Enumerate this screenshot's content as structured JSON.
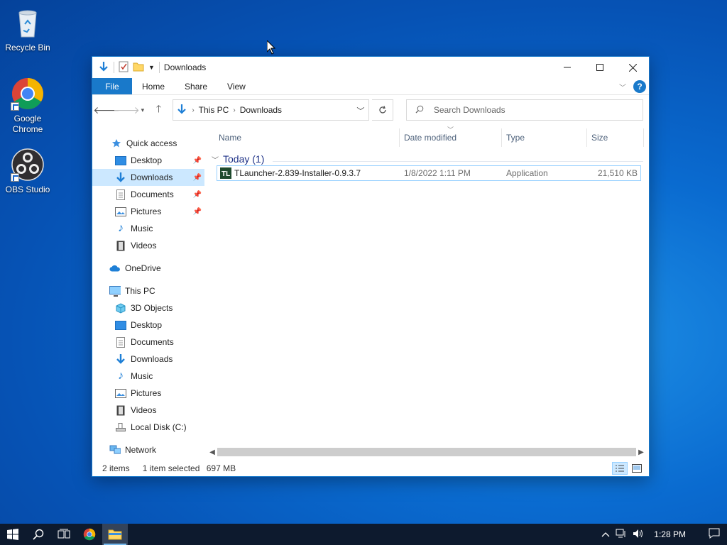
{
  "desktop": {
    "icons": [
      {
        "label": "Recycle Bin"
      },
      {
        "label": "Google Chrome"
      },
      {
        "label": "OBS Studio"
      }
    ]
  },
  "window": {
    "title": "Downloads",
    "ribbon_tabs": [
      "File",
      "Home",
      "Share",
      "View"
    ],
    "help_label": "?",
    "address": {
      "crumbs": [
        "This PC",
        "Downloads"
      ]
    },
    "search": {
      "placeholder": "Search Downloads"
    },
    "nav": {
      "quick_access": "Quick access",
      "quick_items": [
        {
          "label": "Desktop",
          "pinned": true
        },
        {
          "label": "Downloads",
          "pinned": true,
          "selected": true
        },
        {
          "label": "Documents",
          "pinned": true
        },
        {
          "label": "Pictures",
          "pinned": true
        },
        {
          "label": "Music",
          "pinned": false
        },
        {
          "label": "Videos",
          "pinned": false
        }
      ],
      "onedrive": "OneDrive",
      "this_pc": "This PC",
      "pc_items": [
        "3D Objects",
        "Desktop",
        "Documents",
        "Downloads",
        "Music",
        "Pictures",
        "Videos",
        "Local Disk (C:)"
      ],
      "network": "Network"
    },
    "columns": {
      "name": "Name",
      "date": "Date modified",
      "type": "Type",
      "size": "Size"
    },
    "group": {
      "label": "Today (1)"
    },
    "files": [
      {
        "name": "TLauncher-2.839-Installer-0.9.3.7",
        "date": "1/8/2022 1:11 PM",
        "type": "Application",
        "size": "21,510 KB"
      }
    ],
    "status": {
      "items": "2 items",
      "selected": "1 item selected",
      "size": "697 MB"
    }
  },
  "taskbar": {
    "time": "1:28 PM"
  },
  "colors": {
    "accent": "#1979ca",
    "selection": "#cce8ff",
    "taskbar": "#0d1a2e"
  }
}
